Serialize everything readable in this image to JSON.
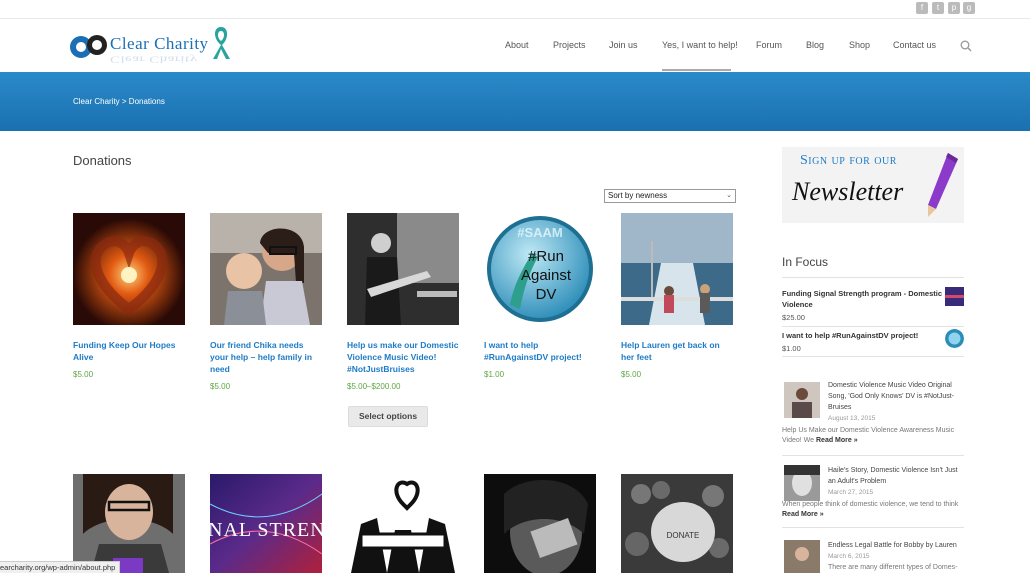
{
  "header": {
    "logo_text": "Clear Charity",
    "nav": [
      "About",
      "Projects",
      "Join us",
      "Yes, I want to help!",
      "Forum",
      "Blog",
      "Shop",
      "Contact us"
    ]
  },
  "social_icons": [
    "facebook-icon",
    "twitter-icon",
    "pinterest-icon",
    "google-plus-icon"
  ],
  "banner": {
    "breadcrumb": "Clear Charity > Donations"
  },
  "main": {
    "title": "Donations",
    "sort": {
      "value": "Sort by newness"
    },
    "products": [
      {
        "title": "Funding Keep Our Hopes Alive",
        "price": "$5.00"
      },
      {
        "title": "Our friend Chika needs your help – help family in need",
        "price": "$5.00"
      },
      {
        "title": "Help us make our Domestic Violence Music Video! #NotJustBruises",
        "price": "$5.00–$200.00",
        "button": "Select options"
      },
      {
        "title": "I want to help #RunAgainstDV project!",
        "price": "$1.00"
      },
      {
        "title": "Help Lauren get back on her feet",
        "price": "$5.00"
      }
    ],
    "row2_image_texts": {
      "signal": "NAL STREN",
      "donate": "DONATE"
    },
    "badge_text": {
      "line1": "#SAAM",
      "line2": "#Run",
      "line3": "Against",
      "line4": "DV"
    }
  },
  "sidebar": {
    "newsletter": {
      "top": "Sign up for our",
      "bottom": "Newsletter"
    },
    "in_focus_heading": "In Focus",
    "in_focus": [
      {
        "title": "Funding Signal Strength program - Domestic Violence",
        "price": "$25.00"
      },
      {
        "title": "I want to help #RunAgainstDV project!",
        "price": "$1.00"
      }
    ],
    "posts": [
      {
        "title": "Domestic Violence Music Video Original Song, 'God Only Knows' DV is #NotJust-Bruises",
        "date": "August 13, 2015",
        "excerpt": "Help Us Make our Domestic Violence Awareness Music Video! We",
        "read_more": "Read More »"
      },
      {
        "title": "Haile's Story, Domestic Violence Isn't Just an Adult's Problem",
        "date": "March 27, 2015",
        "excerpt": "When people think of domestic violence, we tend to think",
        "read_more": "Read More »"
      },
      {
        "title": "Endless Legal Battle for Bobby by Lauren",
        "date": "March 6, 2015",
        "excerpt": "There are many different types of Domes-"
      }
    ]
  },
  "status_bar": {
    "url": "earcharity.org/wp-admin/about.php"
  }
}
